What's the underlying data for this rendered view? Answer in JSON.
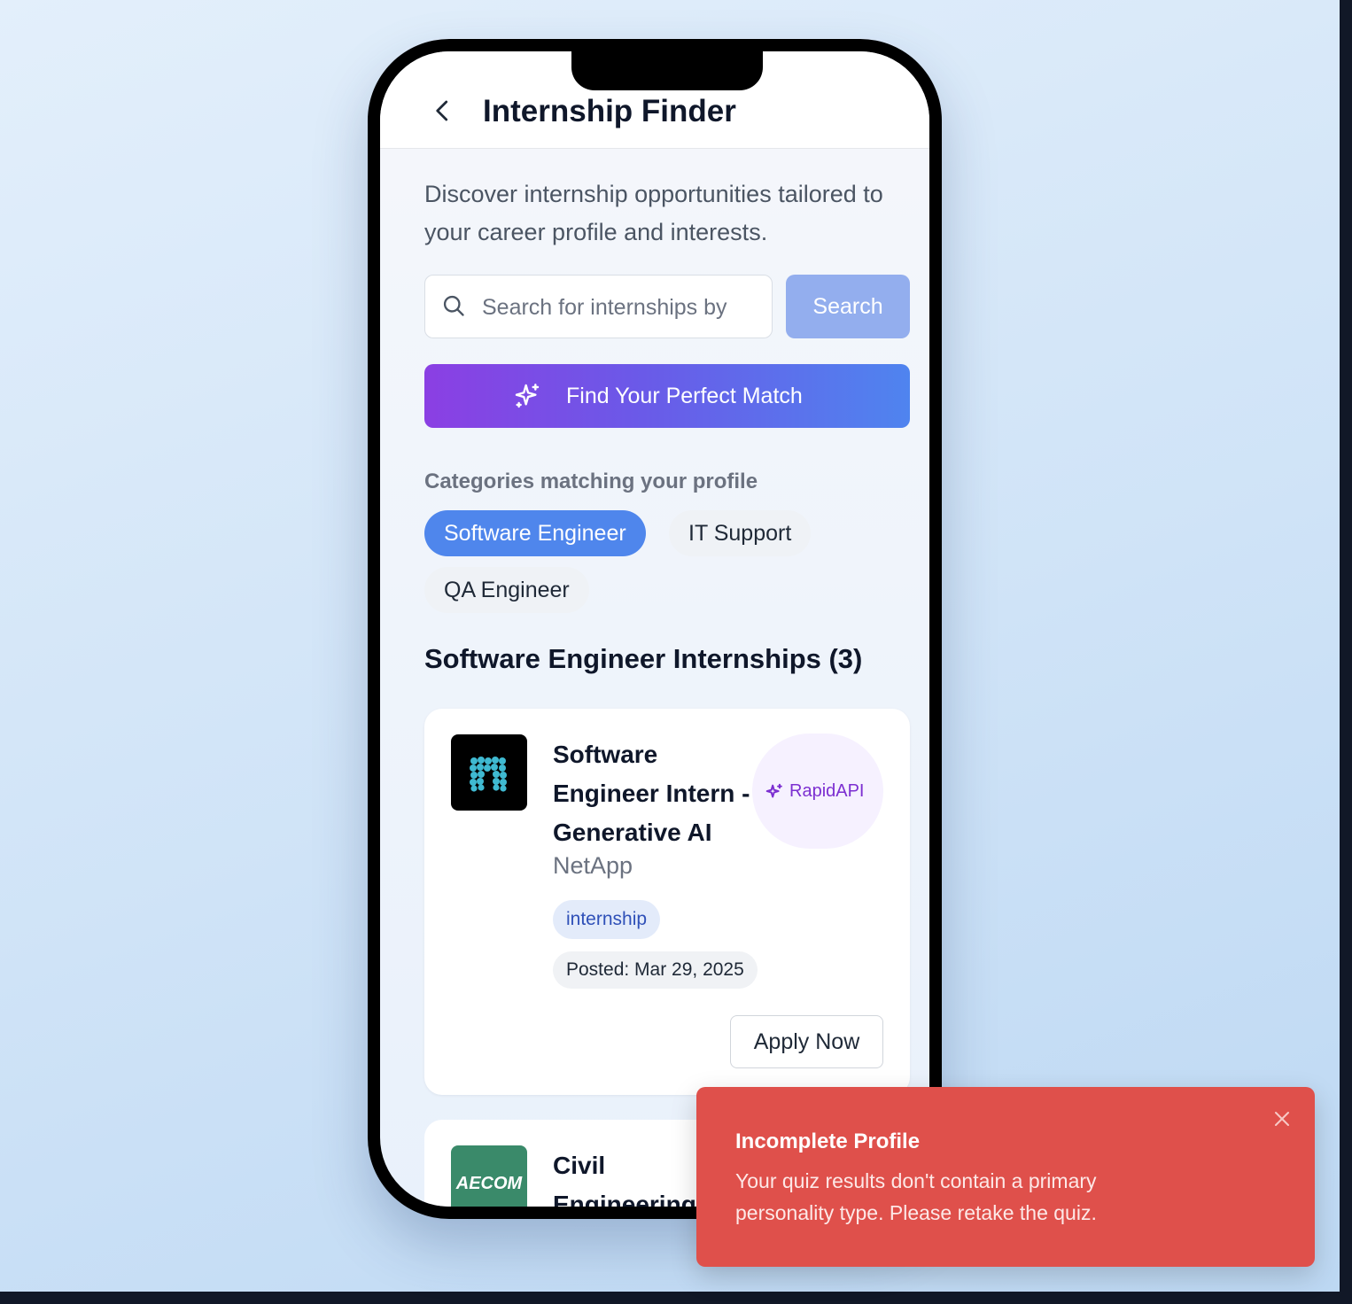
{
  "app": {
    "title": "Internship Finder"
  },
  "intro": {
    "text": "Discover internship opportunities tailored to your career profile and interests."
  },
  "search": {
    "placeholder": "Search for internships by",
    "value": "",
    "button_label": "Search"
  },
  "match_button": {
    "label": "Find Your Perfect Match"
  },
  "categories": {
    "heading": "Categories matching your profile",
    "items": [
      {
        "label": "Software Engineer",
        "active": true
      },
      {
        "label": "IT Support",
        "active": false
      },
      {
        "label": "QA Engineer",
        "active": false
      }
    ]
  },
  "listings": {
    "heading": "Software Engineer Internships (3)",
    "items": [
      {
        "title": "Software Engineer Intern - Generative AI",
        "company": "NetApp",
        "source": "RapidAPI",
        "type": "internship",
        "posted": "Posted: Mar 29, 2025",
        "apply_label": "Apply Now",
        "logo_text": ""
      },
      {
        "title": "Civil Engineering",
        "logo_text": "AECOM"
      }
    ]
  },
  "toast": {
    "title": "Incomplete Profile",
    "message": "Your quiz results don't contain a primary personality type. Please retake the quiz."
  },
  "colors": {
    "accent": "#4f86ec",
    "gradient_start": "#8b3fe3",
    "gradient_end": "#4f84ef",
    "toast": "#df504b",
    "source_badge_text": "#7c2fd1"
  }
}
